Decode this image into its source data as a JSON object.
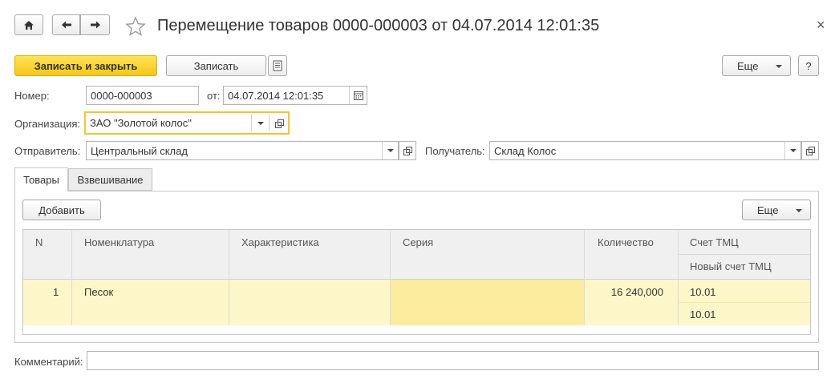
{
  "window": {
    "title": "Перемещение товаров 0000-000003 от 04.07.2014 12:01:35",
    "close_glyph": "×"
  },
  "toolbar": {
    "save_close_label": "Записать и закрыть",
    "save_label": "Записать",
    "more_label": "Еще",
    "help_label": "?"
  },
  "form": {
    "number_label": "Номер:",
    "number_value": "0000-000003",
    "date_label": "от:",
    "date_value": "04.07.2014 12:01:35",
    "org_label": "Организация:",
    "org_value": "ЗАО \"Золотой колос\"",
    "sender_label": "Отправитель:",
    "sender_value": "Центральный склад",
    "receiver_label": "Получатель:",
    "receiver_value": "Склад Колос",
    "comment_label": "Комментарий:",
    "comment_value": ""
  },
  "tabs": [
    {
      "label": "Товары",
      "active": true
    },
    {
      "label": "Взвешивание",
      "active": false
    }
  ],
  "table_toolbar": {
    "add_label": "Добавить",
    "more_label": "Еще"
  },
  "table": {
    "columns": {
      "n": "N",
      "nomenclature": "Номенклатура",
      "characteristic": "Характеристика",
      "series": "Серия",
      "quantity": "Количество",
      "account": "Счет ТМЦ",
      "new_account": "Новый счет ТМЦ"
    },
    "rows": [
      {
        "n": "1",
        "nomenclature": "Песок",
        "characteristic": "",
        "series": "",
        "quantity": "16 240,000",
        "account": "10.01",
        "new_account": "10.01"
      }
    ]
  },
  "colors": {
    "accent_yellow": "#f5c71a",
    "row_highlight": "#fdf6c8",
    "cell_selected": "#fcec9e"
  }
}
